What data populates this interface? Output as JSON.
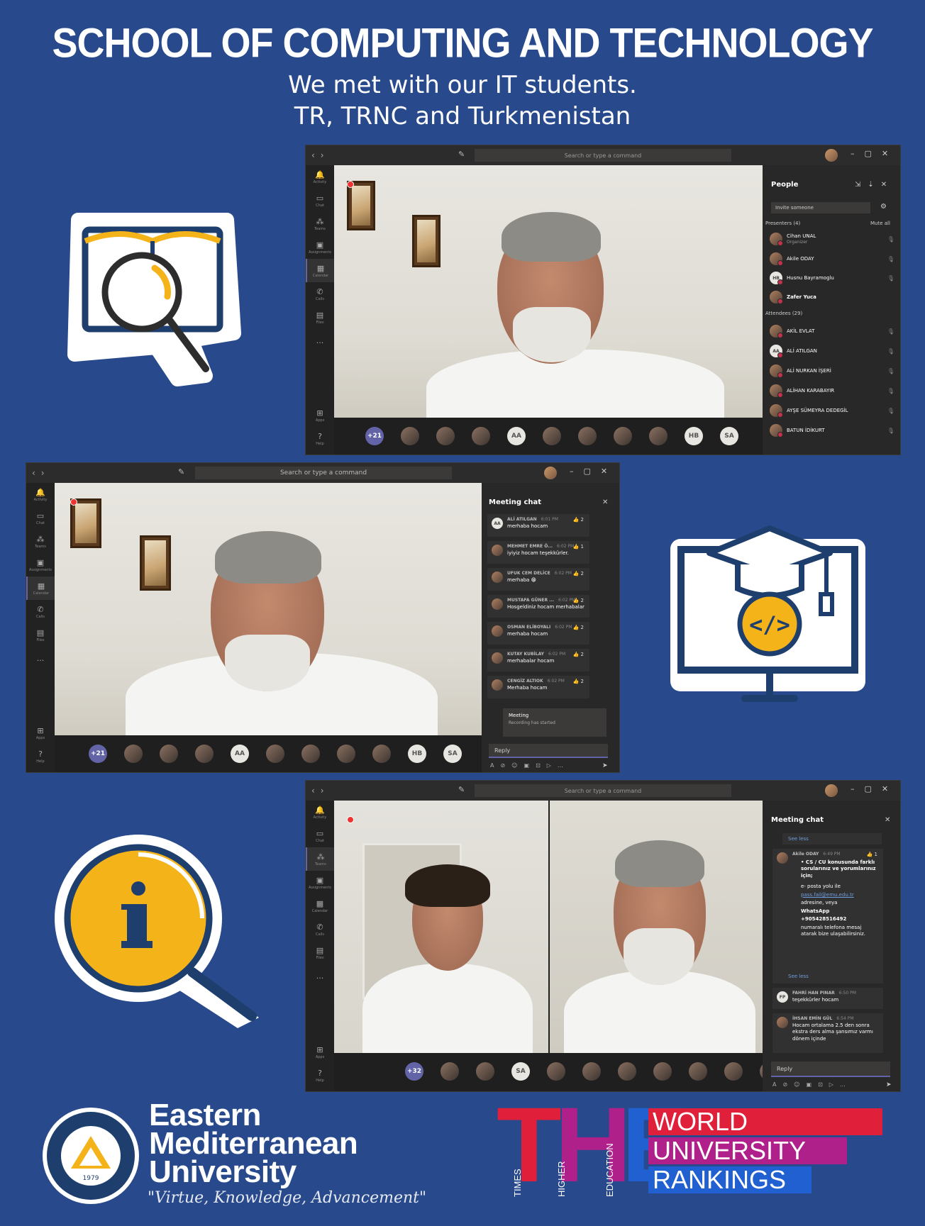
{
  "header": {
    "title": "SCHOOL OF COMPUTING AND TECHNOLOGY",
    "subtitle_line1": "We met with our IT students.",
    "subtitle_line2": "TR, TRNC and Turkmenistan"
  },
  "teams_common": {
    "search_placeholder": "Search or type a command",
    "rail": [
      {
        "label": "Activity",
        "icon": "bell-icon"
      },
      {
        "label": "Chat",
        "icon": "chat-icon"
      },
      {
        "label": "Teams",
        "icon": "teams-icon"
      },
      {
        "label": "Assignments",
        "icon": "assignments-icon"
      },
      {
        "label": "Calendar",
        "icon": "calendar-icon"
      },
      {
        "label": "Calls",
        "icon": "phone-icon"
      },
      {
        "label": "Files",
        "icon": "files-icon"
      }
    ],
    "rail_more": "...",
    "rail_apps": "Apps",
    "rail_help": "Help",
    "reply_placeholder": "Reply"
  },
  "window1": {
    "people_title": "People",
    "invite_placeholder": "Invite someone",
    "presenters_label": "Presenters (4)",
    "mute_all": "Mute all",
    "presenters": [
      {
        "name": "Cihan UNAL",
        "role": "Organizer"
      },
      {
        "name": "Akile ODAY",
        "role": ""
      },
      {
        "name": "Husnu Bayramoglu",
        "role": "",
        "initials": "HB"
      },
      {
        "name": "Zafer Yuca",
        "role": ""
      }
    ],
    "attendees_label": "Attendees (29)",
    "attendees": [
      {
        "name": "AKİL EVLAT"
      },
      {
        "name": "ALİ ATILGAN",
        "initials": "AA"
      },
      {
        "name": "ALİ NURKAN İŞERİ"
      },
      {
        "name": "ALİHAN KARABAYIR"
      },
      {
        "name": "AYŞE SÜMEYRA DEDEGİL"
      },
      {
        "name": "BATUN İDİKURT"
      }
    ],
    "strip": [
      "+21",
      "",
      "",
      "",
      "AA",
      "",
      "",
      "",
      "",
      "HB",
      "SA"
    ]
  },
  "window2": {
    "chat_title": "Meeting chat",
    "messages": [
      {
        "sender": "ALİ ATILGAN",
        "time": "6:01 PM",
        "text": "merhaba hocam",
        "likes": "2",
        "initials": "AA"
      },
      {
        "sender": "MEHMET EMRE Ö...",
        "time": "6:02 PM",
        "text": "iyiyiz hocam teşekkürler.",
        "likes": "1"
      },
      {
        "sender": "UFUK CEM DELİCE",
        "time": "6:02 PM",
        "text": "merhaba 😁",
        "likes": "2"
      },
      {
        "sender": "MUSTAFA GÜNER ...",
        "time": "6:02 PM",
        "text": "Hosgeldiniz hocam merhabalar",
        "likes": "2"
      },
      {
        "sender": "OSMAN ELİBOYALI",
        "time": "6:02 PM",
        "text": "merhaba hocam",
        "likes": "2"
      },
      {
        "sender": "KUTAY KUBİLAY",
        "time": "6:02 PM",
        "text": "merhabalar hocam",
        "likes": "2"
      },
      {
        "sender": "CENGİZ ALTIOK",
        "time": "6:02 PM",
        "text": "Merhaba hocam",
        "likes": "2"
      }
    ],
    "meeting_card_title": "Meeting",
    "meeting_card_text": "Recording has started",
    "strip": [
      "+21",
      "",
      "",
      "",
      "AA",
      "",
      "",
      "",
      "",
      "HB",
      "SA"
    ]
  },
  "window3": {
    "chat_title": "Meeting chat",
    "see_less": "See less",
    "akile": {
      "sender": "Akile ODAY",
      "time": "6:49 PM",
      "likes": "1",
      "bullet": "CS / CU konusunda farklı sorularınız ve yorumlarınız için;",
      "l1": "e- posta yolu ile",
      "email": "pass.fail@emu.edu.tr",
      "l2": "adresine, veya",
      "l3": "WhatsApp",
      "phone": "+905428516492",
      "l4": "numaralı telefona mesaj atarak bize ulaşabilirsiniz."
    },
    "m2": {
      "sender": "FAHRİ HAN PINAR",
      "time": "6:50 PM",
      "text": "teşekkürler hocam",
      "initials": "FP"
    },
    "m3": {
      "sender": "İHSAN EMİN GÜL",
      "time": "6:54 PM",
      "text": "Hocam ortalama 2.5 den sonra ekstra ders alma şansımız varmı dönem içinde"
    },
    "strip": [
      "+32",
      "",
      "",
      "SA",
      "",
      "",
      "",
      "",
      "",
      "",
      ""
    ]
  },
  "footer": {
    "university_line1": "Eastern",
    "university_line2": "Mediterranean",
    "university_line3": "University",
    "motto": "\"Virtue, Knowledge, Advancement\"",
    "seal_year": "1979",
    "the_letters": "THE",
    "the_times": "TIMES",
    "the_higher": "HIGHER",
    "the_education": "EDUCATION",
    "rank1": "WORLD",
    "rank2": "UNIVERSITY",
    "rank3": "RANKINGS"
  },
  "colors": {
    "background": "#284a8c",
    "teams_accent": "#6264a7",
    "the_red": "#e0203a",
    "the_magenta": "#b0208a",
    "the_blue": "#2060d0",
    "yellow": "#f5b31a",
    "navy": "#1e3f6e"
  }
}
